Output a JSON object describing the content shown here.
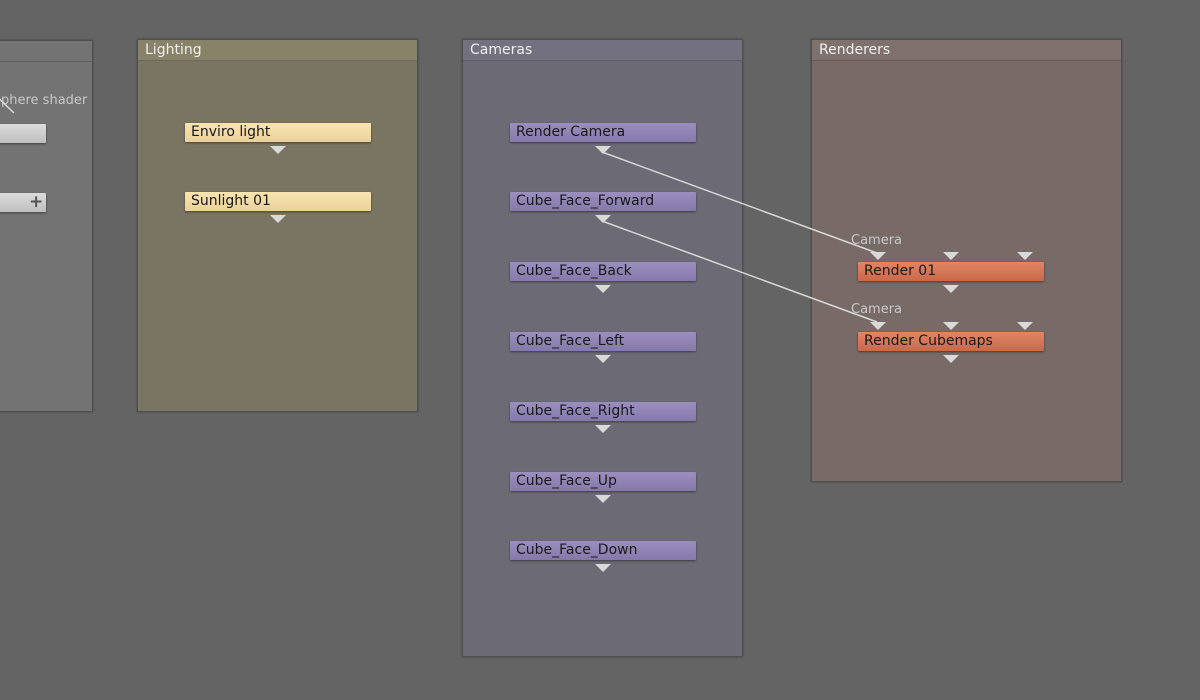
{
  "groups": {
    "left": {
      "label": "phere shader"
    },
    "lighting": {
      "title": "Lighting",
      "nodes": [
        "Enviro light",
        "Sunlight 01"
      ]
    },
    "cameras": {
      "title": "Cameras",
      "nodes": [
        "Render Camera",
        "Cube_Face_Forward",
        "Cube_Face_Back",
        "Cube_Face_Left",
        "Cube_Face_Right",
        "Cube_Face_Up",
        "Cube_Face_Down"
      ]
    },
    "renderers": {
      "title": "Renderers",
      "input_label": "Camera",
      "nodes": [
        "Render 01",
        "Render Cubemaps"
      ]
    }
  },
  "connections": [
    {
      "from": "Render Camera",
      "to": "Render 01",
      "input": "Camera"
    },
    {
      "from": "Cube_Face_Forward",
      "to": "Render Cubemaps",
      "input": "Camera"
    }
  ],
  "colors": {
    "background": "#646464",
    "lighting_group": "#7a7563",
    "camera_group": "#6c6a75",
    "renderer_group": "#776a67",
    "light_node": "#f3deab",
    "camera_node": "#8f85b5",
    "renderer_node": "#d57857",
    "wire": "#d9d9d9"
  }
}
